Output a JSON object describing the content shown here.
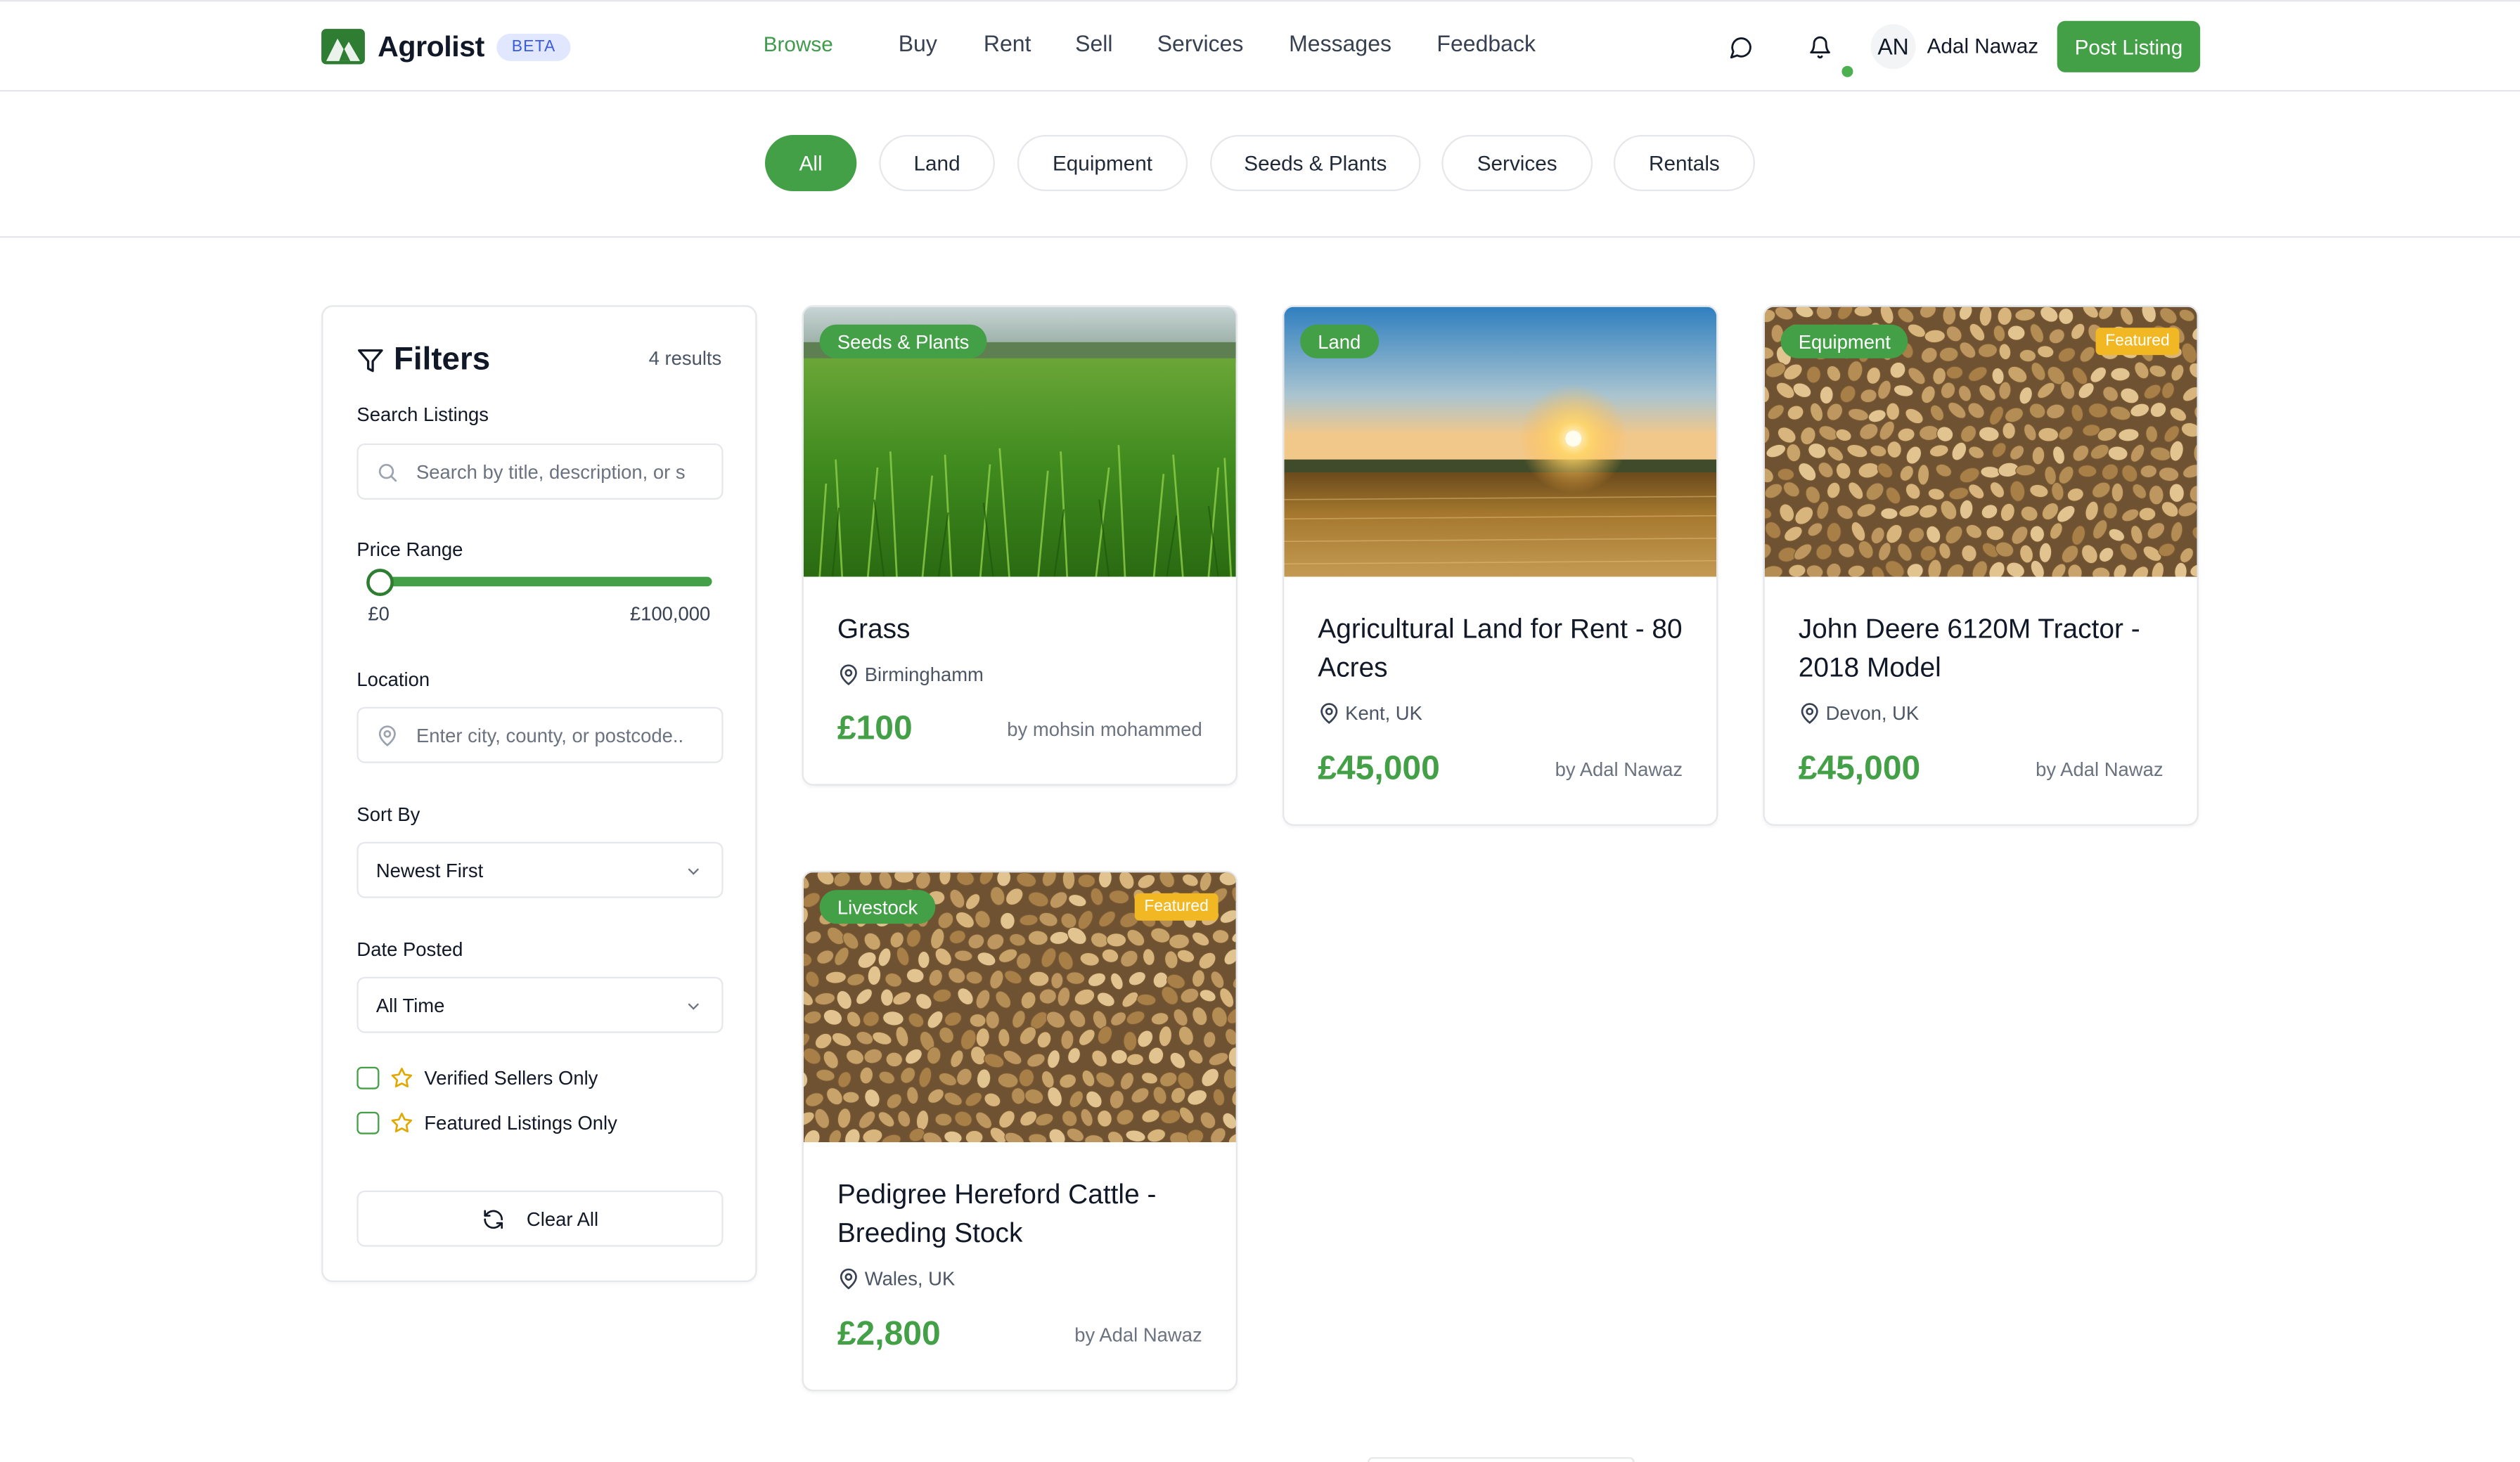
{
  "header": {
    "brand_name": "Agrolist",
    "beta_label": "BETA",
    "nav": [
      "Browse",
      "Buy",
      "Rent",
      "Sell",
      "Services",
      "Messages",
      "Feedback"
    ],
    "user_initials": "AN",
    "user_name": "Adal Nawaz",
    "post_listing_label": "Post Listing"
  },
  "categories": [
    "All",
    "Land",
    "Equipment",
    "Seeds & Plants",
    "Services",
    "Rentals"
  ],
  "active_category": "All",
  "filters": {
    "title": "Filters",
    "results": "4 results",
    "search_label": "Search Listings",
    "search_placeholder": "Search by title, description, or s",
    "price_label": "Price Range",
    "price_min": "£0",
    "price_max": "£100,000",
    "price_position_fraction": 0.0,
    "location_label": "Location",
    "location_placeholder": "Enter city, county, or postcode..",
    "sort_label": "Sort By",
    "sort_value": "Newest First",
    "date_label": "Date Posted",
    "date_value": "All Time",
    "verified_label": "Verified Sellers Only",
    "verified_checked": false,
    "featured_label": "Featured Listings Only",
    "featured_checked": false,
    "clear_label": "Clear All"
  },
  "listings": [
    {
      "category": "Seeds & Plants",
      "featured": false,
      "title": "Grass",
      "location": "Birminghamm",
      "price": "£100",
      "seller": "by mohsin mohammed",
      "image": "grass"
    },
    {
      "category": "Land",
      "featured": false,
      "title": "Agricultural Land for Rent - 80 Acres",
      "location": "Kent, UK",
      "price": "£45,000",
      "seller": "by Adal Nawaz",
      "image": "sunset-field"
    },
    {
      "category": "Equipment",
      "featured": true,
      "featured_label": "Featured",
      "title": "John Deere 6120M Tractor - 2018 Model",
      "location": "Devon, UK",
      "price": "£45,000",
      "seller": "by Adal Nawaz",
      "image": "wheat-grains"
    },
    {
      "category": "Livestock",
      "featured": true,
      "featured_label": "Featured",
      "title": "Pedigree Hereford Cattle - Breeding Stock",
      "location": "Wales, UK",
      "price": "£2,800",
      "seller": "by Adal Nawaz",
      "image": "wheat-grains"
    }
  ],
  "colors": {
    "brand_green": "#43a047",
    "featured_yellow": "#f2b824",
    "beta_blue": "#3b5bdb"
  },
  "icons": [
    "logo-icon",
    "chat-icon",
    "bell-icon",
    "filter-icon",
    "search-icon",
    "location-pin-icon",
    "chevron-down-icon",
    "star-icon",
    "refresh-icon"
  ]
}
